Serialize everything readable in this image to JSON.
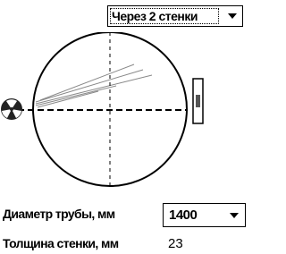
{
  "mode_select": {
    "selected": "Через 2 стенки"
  },
  "pipe": {
    "diameter_label": "Диаметр трубы, мм",
    "diameter_value": "1400",
    "thickness_label": "Толщина стенки, мм",
    "thickness_value": "23"
  },
  "icons": {
    "source": "radiation-source-icon",
    "detector": "detector-film-icon",
    "dropdown_arrow": "chevron-down-icon"
  }
}
